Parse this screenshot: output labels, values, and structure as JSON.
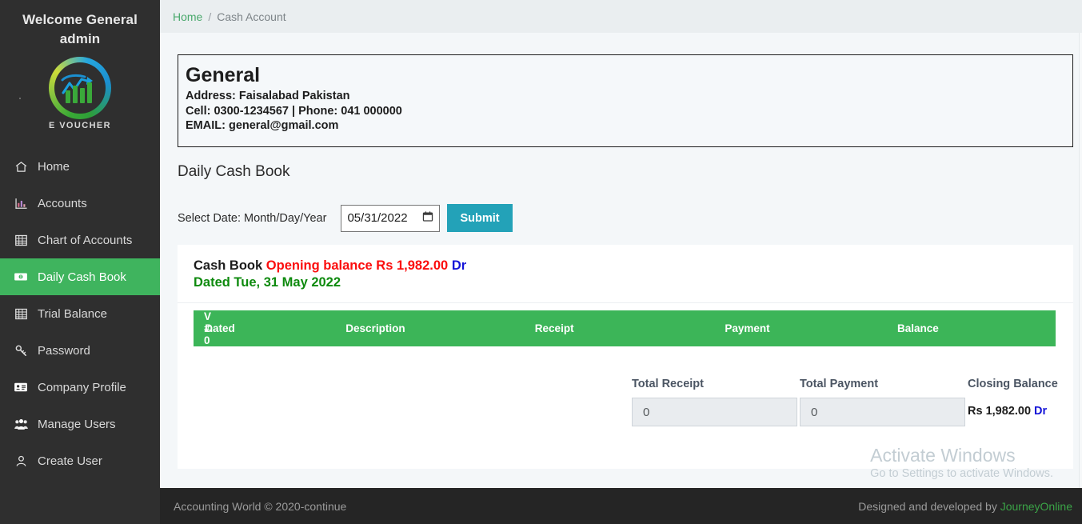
{
  "sidebar": {
    "welcome": "Welcome General admin",
    "logo_text": "E VOUCHER",
    "items": [
      {
        "label": "Home",
        "icon": "home-icon",
        "active": false
      },
      {
        "label": "Accounts",
        "icon": "bar-chart-icon",
        "active": false
      },
      {
        "label": "Chart of Accounts",
        "icon": "grid-icon",
        "active": false
      },
      {
        "label": "Daily Cash Book",
        "icon": "cash-icon",
        "active": true
      },
      {
        "label": "Trial Balance",
        "icon": "grid-icon",
        "active": false
      },
      {
        "label": "Password",
        "icon": "key-icon",
        "active": false
      },
      {
        "label": "Company Profile",
        "icon": "id-card-icon",
        "active": false
      },
      {
        "label": "Manage Users",
        "icon": "users-icon",
        "active": false
      },
      {
        "label": "Create User",
        "icon": "user-icon",
        "active": false
      }
    ]
  },
  "breadcrumb": {
    "home": "Home",
    "separator": "/",
    "current": "Cash Account"
  },
  "company": {
    "name": "General",
    "address": "Address: Faisalabad Pakistan",
    "contact": "Cell: 0300-1234567 | Phone: 041 000000",
    "email": "EMAIL: general@gmail.com"
  },
  "page": {
    "title": "Daily Cash Book"
  },
  "form": {
    "date_label": "Select Date: Month/Day/Year",
    "date_value": "05/31/2022",
    "date_icon": "calendar-icon",
    "submit_label": "Submit"
  },
  "cashbook": {
    "title": "Cash Book",
    "opening_text": "Opening balance Rs 1,982.00",
    "opening_suffix": "Dr",
    "dated": "Dated Tue, 31 May 2022",
    "columns": [
      "V #. 0",
      "Dated",
      "Description",
      "Receipt",
      "Payment",
      "Balance"
    ],
    "rows": [],
    "totals": {
      "receipt_label": "Total Receipt",
      "receipt_value": "0",
      "payment_label": "Total Payment",
      "payment_value": "0",
      "closing_label": "Closing Balance",
      "closing_value": "Rs 1,982.00",
      "closing_suffix": "Dr"
    }
  },
  "watermark": {
    "line1": "Activate Windows",
    "line2": "Go to Settings to activate Windows."
  },
  "footer": {
    "left": "Accounting World © 2020-continue",
    "right_prefix": "Designed and developed by",
    "right_link": "JourneyOnline"
  },
  "colors": {
    "sidebar_bg": "#2f2f2f",
    "active_green": "#3fb45e",
    "table_header_green": "#3cb558",
    "submit_teal": "#23a2b8",
    "red": "#fb0d0d",
    "blue": "#1414d8",
    "green_text": "#0e8a0e",
    "footer_bg": "#252525",
    "link_green": "#3ba447"
  }
}
